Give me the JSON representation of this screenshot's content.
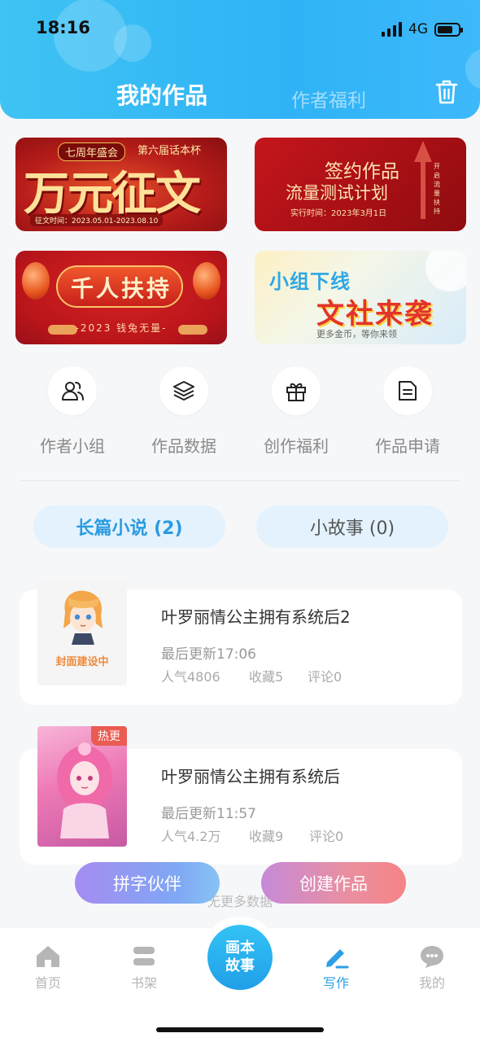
{
  "status": {
    "time": "18:16",
    "network": "4G"
  },
  "header": {
    "tab_active": "我的作品",
    "tab_inactive": "作者福利",
    "trash_icon": "trash-icon"
  },
  "banners": {
    "b1": {
      "tag": "七周年盛会",
      "sub": "第六届话本杯",
      "big": "万元征文",
      "date": "征文时间：2023.05.01-2023.08.10"
    },
    "b2": {
      "line1": "签约作品",
      "line2": "流量测试计划",
      "line3": "实行时间：2023年3月1日",
      "vertical": "开启流量扶持"
    },
    "b3": {
      "title": "千人扶持",
      "sub": "-2023 钱兔无量-"
    },
    "b4": {
      "line1": "小组下线",
      "line2": "文社来袭",
      "line3": "更多金币，等你来领"
    }
  },
  "quick_actions": [
    {
      "label": "作者小组",
      "icon": "users-icon"
    },
    {
      "label": "作品数据",
      "icon": "layers-icon"
    },
    {
      "label": "创作福利",
      "icon": "gift-icon"
    },
    {
      "label": "作品申请",
      "icon": "document-icon"
    }
  ],
  "segments": {
    "novel": "长篇小说 (2)",
    "story": "小故事 (0)"
  },
  "works": [
    {
      "title": "叶罗丽情公主拥有系统后2",
      "updated": "最后更新17:06",
      "popularity": "人气4806",
      "favorites": "收藏5",
      "comments": "评论0",
      "cover_text": "封面建设中"
    },
    {
      "title": "叶罗丽情公主拥有系统后",
      "updated": "最后更新11:57",
      "popularity": "人气4.2万",
      "favorites": "收藏9",
      "comments": "评论0",
      "badge": "热更"
    }
  ],
  "no_more": "无更多数据",
  "floating": {
    "partner": "拼字伙伴",
    "create": "创建作品"
  },
  "tabbar": {
    "home": "首页",
    "shelf": "书架",
    "center_line1": "画本",
    "center_line2": "故事",
    "write": "写作",
    "me": "我的"
  },
  "colors": {
    "accent": "#2d9fe4",
    "header": "#33b6f5"
  }
}
